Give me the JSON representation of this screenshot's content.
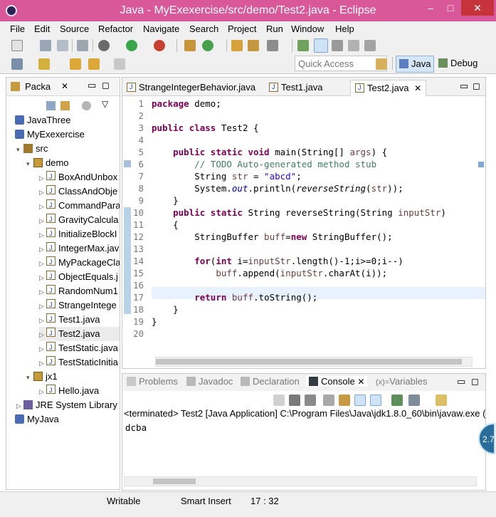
{
  "window": {
    "title": "Java - MyExexercise/src/demo/Test2.java - Eclipse",
    "controls": {
      "minimize": "–",
      "maximize": "□",
      "close": "✕"
    }
  },
  "menu": [
    "File",
    "Edit",
    "Source",
    "Refactor",
    "Navigate",
    "Search",
    "Project",
    "Run",
    "Window",
    "Help"
  ],
  "toolbar": {
    "quick_access_placeholder": "Quick Access",
    "perspective_java": "Java",
    "perspective_debug": "Debug"
  },
  "package_explorer": {
    "tab_label": "Packa",
    "tree": [
      {
        "label": "JavaThree",
        "kind": "project"
      },
      {
        "label": "MyExexercise",
        "kind": "project"
      },
      {
        "label": "src",
        "kind": "src"
      },
      {
        "label": "demo",
        "kind": "package"
      },
      {
        "label": "BoxAndUnbox",
        "kind": "file"
      },
      {
        "label": "ClassAndObje",
        "kind": "file"
      },
      {
        "label": "CommandPara",
        "kind": "file"
      },
      {
        "label": "GravityCalcula",
        "kind": "file"
      },
      {
        "label": "InitializeBlockI",
        "kind": "file"
      },
      {
        "label": "IntegerMax.jav",
        "kind": "file"
      },
      {
        "label": "MyPackageCla",
        "kind": "file"
      },
      {
        "label": "ObjectEquals.j",
        "kind": "file"
      },
      {
        "label": "RandomNum1",
        "kind": "file"
      },
      {
        "label": "StrangeIntege",
        "kind": "file"
      },
      {
        "label": "Test1.java",
        "kind": "file"
      },
      {
        "label": "Test2.java",
        "kind": "file"
      },
      {
        "label": "TestStatic.java",
        "kind": "file"
      },
      {
        "label": "TestStaticInitia",
        "kind": "file"
      },
      {
        "label": "jx1",
        "kind": "package"
      },
      {
        "label": "Hello.java",
        "kind": "file"
      },
      {
        "label": "JRE System Library [",
        "kind": "library"
      },
      {
        "label": "MyJava",
        "kind": "project"
      }
    ]
  },
  "editor": {
    "tabs": [
      {
        "label": "StrangeIntegerBehavior.java"
      },
      {
        "label": "Test1.java"
      },
      {
        "label": "Test2.java",
        "active": true
      }
    ],
    "code": [
      "package demo;",
      "",
      "public class Test2 {",
      "",
      "    public static void main(String[] args) {",
      "        // TODO Auto-generated method stub",
      "        String str = \"abcd\";",
      "        System.out.println(reverseString(str));",
      "    }",
      "    public static String reverseString(String inputStr)",
      "    {",
      "        StringBuffer buff=new StringBuffer();",
      "",
      "        for(int i=inputStr.length()-1;i>=0;i--)",
      "            buff.append(inputStr.charAt(i));",
      "",
      "        return buff.toString();",
      "    }",
      "}",
      ""
    ],
    "line_numbers": [
      "1",
      "2",
      "3",
      "4",
      "5",
      "6",
      "7",
      "8",
      "9",
      "10",
      "11",
      "12",
      "13",
      "14",
      "15",
      "16",
      "17",
      "18",
      "19",
      "20"
    ]
  },
  "console": {
    "tabs": [
      "Problems",
      "Javadoc",
      "Declaration",
      "Console",
      "Variables"
    ],
    "terminated": "<terminated> Test2 [Java Application] C:\\Program Files\\Java\\jdk1.8.0_60\\bin\\javaw.exe (",
    "output": "dcba"
  },
  "status": {
    "writable": "Writable",
    "insert_mode": "Smart Insert",
    "position": "17 : 32"
  },
  "colors": {
    "titlebar": "#d8589a",
    "keyword": "#7f0055",
    "comment": "#3f7f5f",
    "string": "#2a00ff"
  }
}
